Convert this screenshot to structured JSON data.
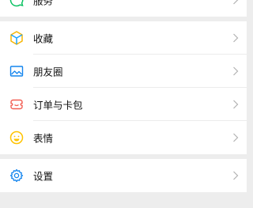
{
  "top_group": {
    "items": [
      {
        "label": "服务",
        "icon": "service-icon"
      }
    ]
  },
  "middle_group": {
    "items": [
      {
        "label": "收藏",
        "icon": "favorites-icon"
      },
      {
        "label": "朋友圈",
        "icon": "moments-icon"
      },
      {
        "label": "订单与卡包",
        "icon": "orders-cards-icon"
      },
      {
        "label": "表情",
        "icon": "sticker-icon"
      }
    ]
  },
  "bottom_group": {
    "items": [
      {
        "label": "设置",
        "icon": "settings-icon"
      }
    ]
  },
  "colors": {
    "background": "#ededed",
    "row_background": "#ffffff",
    "chevron": "#b2b2b2",
    "service_green": "#07c160",
    "favorites_yellow": "#f7b500",
    "favorites_blue": "#1aa3ff",
    "moments_blue": "#1485ee",
    "orders_red": "#f25e53",
    "sticker_yellow": "#ffc300",
    "settings_blue": "#1485ee"
  }
}
